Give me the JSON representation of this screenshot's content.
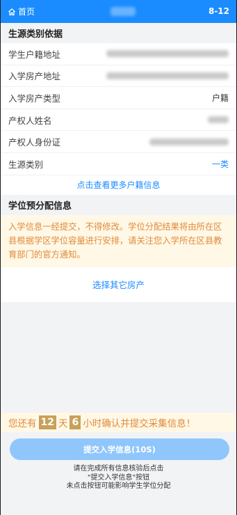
{
  "header": {
    "home_label": "首页",
    "date": "8-12"
  },
  "basis": {
    "title": "生源类别依据",
    "rows": [
      {
        "label": "学生户籍地址"
      },
      {
        "label": "入学房产地址"
      },
      {
        "label": "入学房产类型",
        "value": "户籍"
      },
      {
        "label": "产权人姓名"
      },
      {
        "label": "产权人身份证"
      },
      {
        "label": "生源类别",
        "value": "一类"
      }
    ],
    "more_link": "点击查看更多户籍信息"
  },
  "allocation": {
    "title": "学位预分配信息",
    "notice": "入学信息一经提交，不得修改。学位分配结果将由所在区县根据学区学位容量进行安排，请关注您入学所在区县教育部门的官方通知。",
    "choose_other": "选择其它房产"
  },
  "countdown": {
    "prefix": "您还有",
    "days": "12",
    "day_unit": "天",
    "hours": "6",
    "suffix": "小时确认并提交采集信息！"
  },
  "submit": {
    "label": "提交入学信息(10S)"
  },
  "hint": {
    "line1": "请在完成所有信息核验后点击",
    "line2": "\"提交入学信息\"按钮",
    "line3": "未点击按钮可能影响学生学位分配"
  },
  "colors": {
    "primary": "#1a8cff",
    "notice_text": "#e28a3b",
    "notice_bg": "#fff8e6",
    "submit_disabled": "#8fc6fb",
    "count_badge": "#c9a05a"
  }
}
